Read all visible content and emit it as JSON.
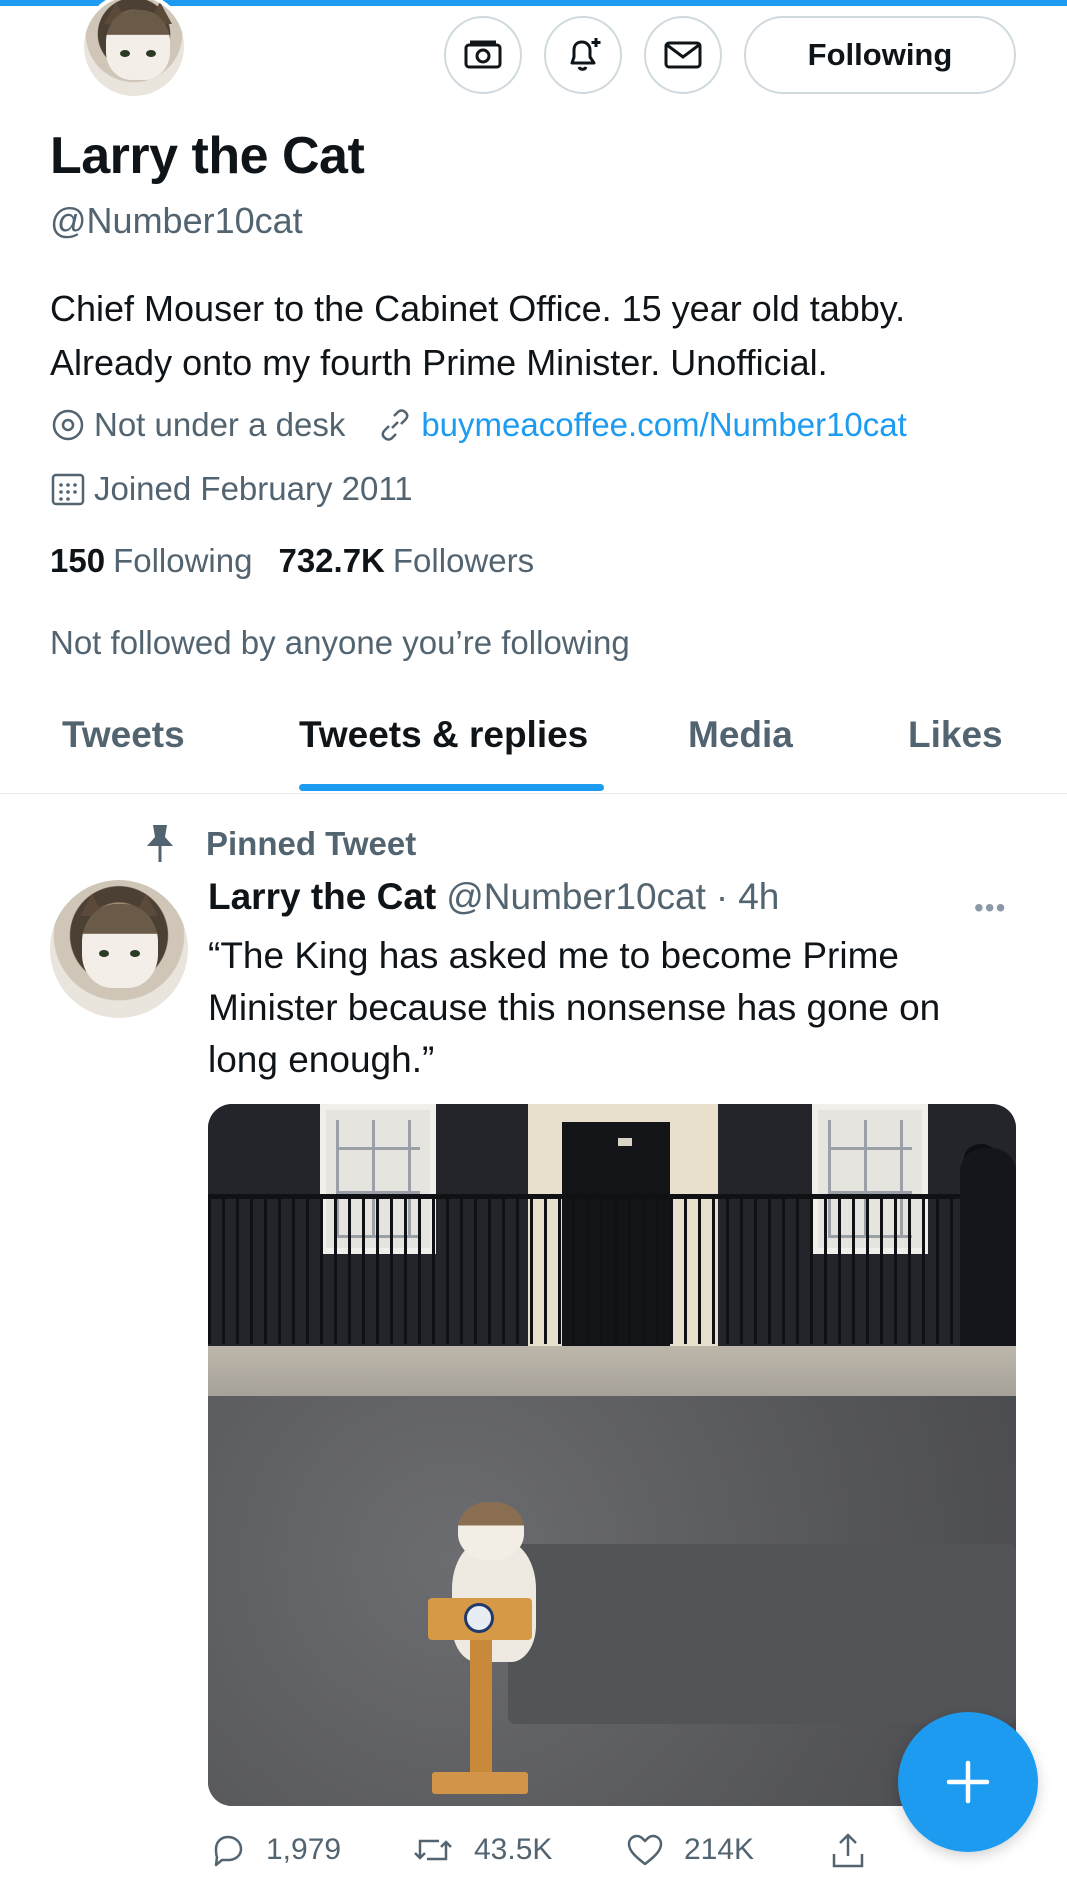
{
  "profile": {
    "name": "Larry the Cat",
    "handle": "@Number10cat",
    "bio": "Chief Mouser to the Cabinet Office. 15 year old tabby. Already onto my fourth Prime Minister. Unofficial.",
    "location": "Not under a desk",
    "website": "buymeacoffee.com/Number10cat",
    "joined": "Joined February 2011",
    "following_count": "150",
    "following_label": "Following",
    "followers_count": "732.7K",
    "followers_label": "Followers",
    "followed_by_note": "Not followed by anyone you’re following",
    "follow_button_label": "Following"
  },
  "header_actions": {
    "icons": [
      "tip-jar-icon",
      "notification-bell-plus-icon",
      "message-envelope-icon"
    ]
  },
  "tabs": [
    {
      "label": "Tweets",
      "active": false
    },
    {
      "label": "Tweets & replies",
      "active": true
    },
    {
      "label": "Media",
      "active": false
    },
    {
      "label": "Likes",
      "active": false
    }
  ],
  "pinned_label": "Pinned Tweet",
  "tweet": {
    "author_name": "Larry the Cat",
    "author_handle": "@Number10cat",
    "separator": "·",
    "time": "4h",
    "more_label": "•••",
    "text": "“The King has asked me to become Prime Minister because this nonsense has gone on long enough.”",
    "replies": "1,979",
    "retweets": "43.5K",
    "likes": "214K"
  },
  "fab_label": "+",
  "colors": {
    "accent": "#1d9bf0",
    "text_primary": "#0f1419",
    "text_secondary": "#536471",
    "border": "#cfd9de"
  }
}
